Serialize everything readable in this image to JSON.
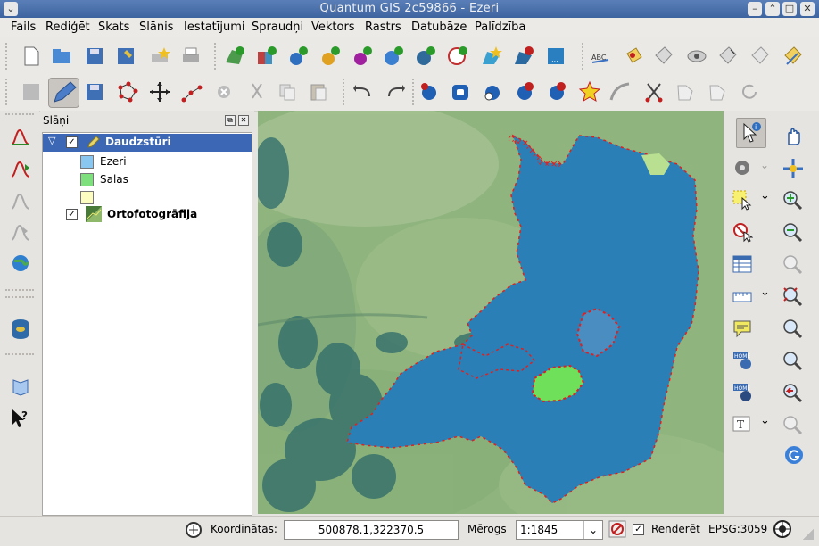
{
  "window": {
    "title": "Quantum GIS 2c59866 - Ezeri"
  },
  "menu": [
    "Fails",
    "Rediģēt",
    "Skats",
    "Slānis",
    "Iestatījumi",
    "Spraudņi",
    "Vektors",
    "Rastrs",
    "Datubāze",
    "Palīdzība"
  ],
  "layers_panel": {
    "title": "Slāņi",
    "layers": [
      {
        "name": "Daudzstūri",
        "checked": true,
        "expanded": true,
        "classes": [
          {
            "label": "Ezeri",
            "color": "#89c7f0"
          },
          {
            "label": "Salas",
            "color": "#7de07d"
          },
          {
            "label": "",
            "color": "#fdfdc2"
          }
        ]
      },
      {
        "name": "Ortofotogrāfija",
        "checked": true
      }
    ]
  },
  "status": {
    "coord_label": "Koordinātas:",
    "coord_value": "500878.1,322370.5",
    "scale_label": "Mērogs",
    "scale_value": "1:1845",
    "render_label": "Renderēt",
    "render_checked": true,
    "crs": "EPSG:3059"
  },
  "colors": {
    "lake": "#2b7fb6",
    "island": "#6ee05a",
    "vertex": "#e02020",
    "selection": "#3c67b4"
  }
}
